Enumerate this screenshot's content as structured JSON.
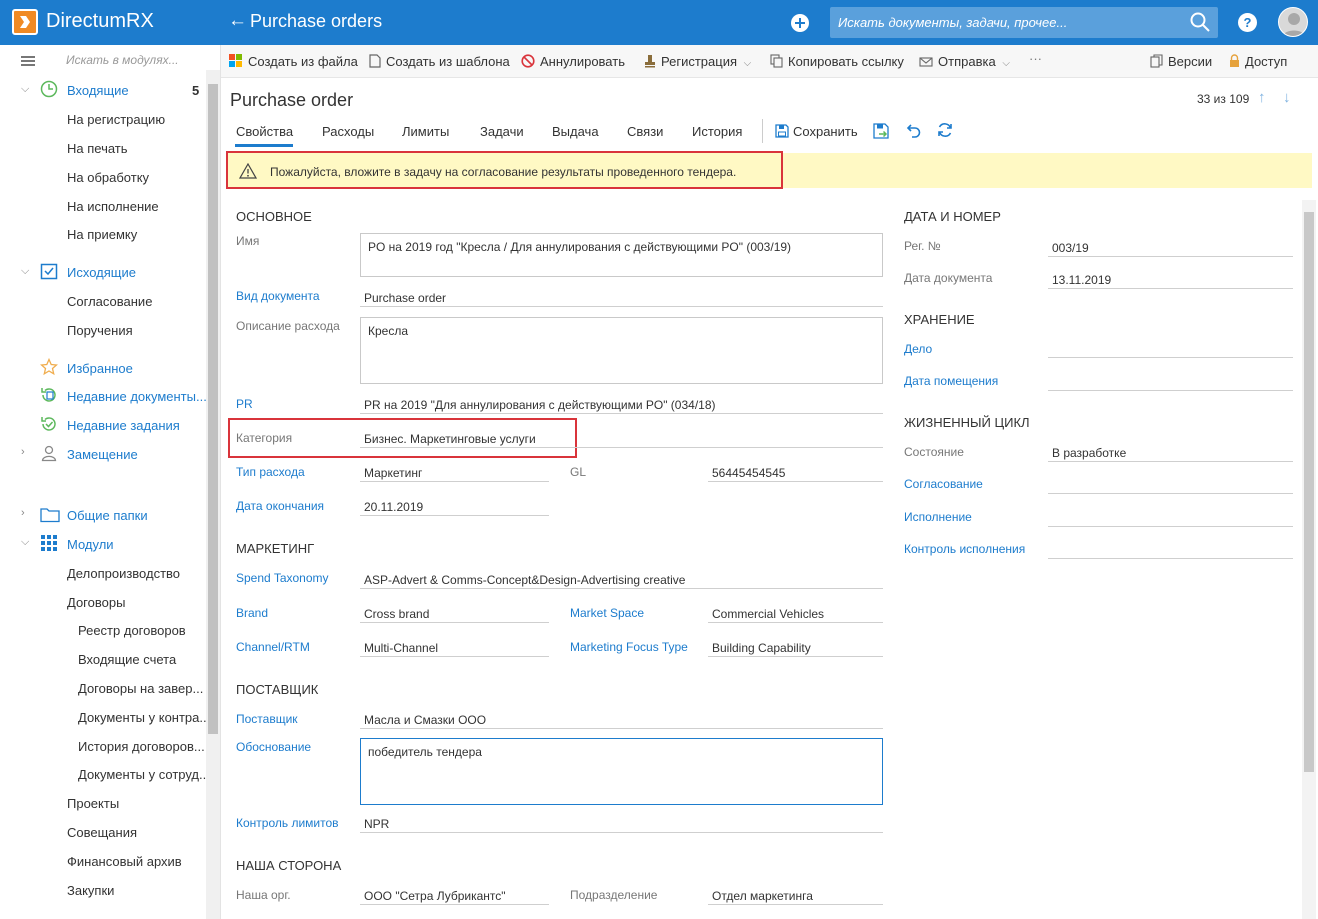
{
  "app": {
    "title": "DirectumRX",
    "module_title": "Purchase orders",
    "back_arrow": "←",
    "search_placeholder": "Искать документы, задачи, прочее...",
    "help_label": "?"
  },
  "sidebar": {
    "search_placeholder": "Искать в модулях...",
    "inbox": {
      "label": "Входящие",
      "count": "5"
    },
    "inbox_items": [
      "На регистрацию",
      "На печать",
      "На обработку",
      "На исполнение",
      "На приемку"
    ],
    "outbox": {
      "label": "Исходящие"
    },
    "outbox_items": [
      "Согласование",
      "Поручения"
    ],
    "favorites": "Избранное",
    "recent_docs": "Недавние документы...",
    "recent_tasks": "Недавние задания",
    "substitution": "Замещение",
    "shared_folders": "Общие папки",
    "modules": "Модули",
    "module_items": [
      "Делопроизводство",
      "Договоры"
    ],
    "contract_items": [
      "Реестр договоров",
      "Входящие счета",
      "Договоры на завер...",
      "Документы у контра...",
      "История договоров...",
      "Документы у сотруд..."
    ],
    "more_modules": [
      "Проекты",
      "Совещания",
      "Финансовый архив",
      "Закупки"
    ]
  },
  "toolbar": {
    "create_from_file": "Создать из файла",
    "create_from_template": "Создать из шаблона",
    "annul": "Аннулировать",
    "registration": "Регистрация",
    "copy_link": "Копировать ссылку",
    "send": "Отправка",
    "more": "···",
    "versions": "Версии",
    "access": "Доступ"
  },
  "document": {
    "title": "Purchase order",
    "pager": "33 из 109",
    "tabs": [
      "Свойства",
      "Расходы",
      "Лимиты",
      "Задачи",
      "Выдача",
      "Связи",
      "История"
    ],
    "save_label": "Сохранить",
    "warning": "Пожалуйста, вложите в задачу на согласование результаты проведенного тендера."
  },
  "main": {
    "section_main": "ОСНОВНОЕ",
    "name_label": "Имя",
    "name_value": "PO на 2019 год \"Кресла / Для аннулирования с действующими PO\" (003/19)",
    "doc_kind_label": "Вид документа",
    "doc_kind_value": "Purchase order",
    "expense_desc_label": "Описание расхода",
    "expense_desc_value": "Кресла",
    "pr_label": "PR",
    "pr_value": "PR на 2019 \"Для аннулирования с действующими PO\" (034/18)",
    "category_label": "Категория",
    "category_value": "Бизнес. Маркетинговые услуги",
    "expense_type_label": "Тип расхода",
    "expense_type_value": "Маркетинг",
    "gl_label": "GL",
    "gl_value": "56445454545",
    "end_date_label": "Дата окончания",
    "end_date_value": "20.11.2019",
    "section_marketing": "МАРКЕТИНГ",
    "spend_taxonomy_label": "Spend Taxonomy",
    "spend_taxonomy_value": "ASP-Advert & Comms-Concept&Design-Advertising creative",
    "brand_label": "Brand",
    "brand_value": "Cross brand",
    "market_space_label": "Market Space",
    "market_space_value": "Commercial Vehicles",
    "channel_label": "Channel/RTM",
    "channel_value": "Multi-Channel",
    "focus_type_label": "Marketing Focus Type",
    "focus_type_value": "Building Capability",
    "section_supplier": "ПОСТАВЩИК",
    "supplier_label": "Поставщик",
    "supplier_value": "Масла и Смазки ООО",
    "justification_label": "Обоснование",
    "justification_value": "победитель тендера",
    "limit_control_label": "Контроль лимитов",
    "limit_control_value": "NPR",
    "section_our_side": "НАША СТОРОНА",
    "our_org_label": "Наша орг.",
    "our_org_value": "ООО \"Сетра Лубрикантс\"",
    "department_label": "Подразделение",
    "department_value": "Отдел маркетинга"
  },
  "right": {
    "section_date_number": "ДАТА И НОМЕР",
    "reg_no_label": "Рег. №",
    "reg_no_value": "003/19",
    "doc_date_label": "Дата документа",
    "doc_date_value": "13.11.2019",
    "section_storage": "ХРАНЕНИЕ",
    "case_label": "Дело",
    "placement_date_label": "Дата помещения",
    "section_lifecycle": "ЖИЗНЕННЫЙ ЦИКЛ",
    "state_label": "Состояние",
    "state_value": "В разработке",
    "approval_label": "Согласование",
    "execution_label": "Исполнение",
    "execution_control_label": "Контроль исполнения"
  }
}
